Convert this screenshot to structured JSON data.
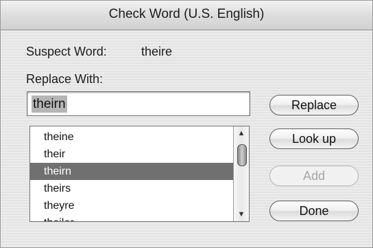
{
  "window": {
    "title": "Check Word (U.S. English)"
  },
  "suspect": {
    "label": "Suspect Word:",
    "value": "theire"
  },
  "replace": {
    "label": "Replace With:",
    "value": "theirn"
  },
  "suggestions": {
    "items": [
      "theine",
      "their",
      "theirn",
      "theirs",
      "theyre",
      "theiler"
    ],
    "selected_index": 2
  },
  "buttons": {
    "replace": "Replace",
    "lookup": "Look up",
    "add": "Add",
    "done": "Done"
  },
  "icons": {
    "scroll_up": "▲",
    "scroll_down": "▼"
  }
}
